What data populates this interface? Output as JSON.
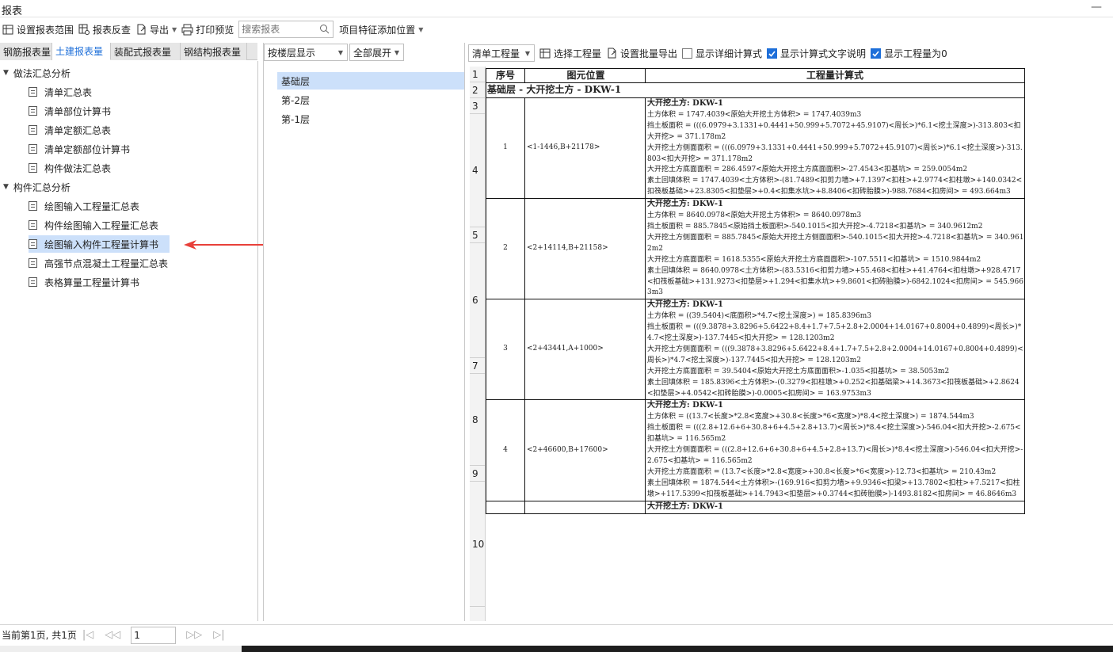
{
  "window": {
    "title": "报表",
    "minimize": "—"
  },
  "toolbar": {
    "set_range": "设置报表范围",
    "report_check": "报表反查",
    "export": "导出",
    "print_preview": "打印预览",
    "search_placeholder": "搜索报表",
    "feature_position": "项目特征添加位置"
  },
  "tabs": [
    "钢筋报表量",
    "土建报表量",
    "装配式报表量",
    "钢结构报表量"
  ],
  "tree": {
    "group1": "做法汇总分析",
    "group1_items": [
      "清单汇总表",
      "清单部位计算书",
      "清单定额汇总表",
      "清单定额部位计算书",
      "构件做法汇总表"
    ],
    "group2": "构件汇总分析",
    "group2_items": [
      "绘图输入工程量汇总表",
      "构件绘图输入工程量汇总表",
      "绘图输入构件工程量计算书",
      "高强节点混凝土工程量汇总表",
      "表格算量工程量计算书"
    ]
  },
  "mid": {
    "floor_mode": "按楼层显示",
    "expand": "全部展开",
    "floors": [
      "基础层",
      "第-2层",
      "第-1层"
    ]
  },
  "rtool": {
    "qty_type": "清单工程量",
    "select_qty": "选择工程量",
    "batch_export": "设置批量导出",
    "show_detail": "显示详细计算式",
    "show_text": "显示计算式文字说明",
    "show_zero": "显示工程量为0"
  },
  "report": {
    "headers": [
      "序号",
      "图元位置",
      "工程量计算式"
    ],
    "floor_row": "基础层 - 大开挖土方 - DKW-1",
    "row_numbers": [
      "1",
      "2",
      "3",
      "4",
      "5",
      "6",
      "7",
      "8",
      "9",
      "10"
    ],
    "rows": [
      {
        "seq": "1",
        "pos": "<1-1446,B+21178>",
        "title": "大开挖土方: DKW-1",
        "formula": "土方体积 = 1747.4039<原始大开挖土方体积> = 1747.4039m3\n挡土板面积 = (((6.0979+3.1331+0.4441+50.999+5.7072+45.9107)<周长>)*6.1<挖土深度>)-313.803<扣大开挖> = 371.178m2\n大开挖土方侧面面积 = (((6.0979+3.1331+0.4441+50.999+5.7072+45.9107)<周长>)*6.1<挖土深度>)-313.803<扣大开挖> = 371.178m2\n大开挖土方底面面积 = 286.4597<原始大开挖土方底面面积>-27.4543<扣基坑> = 259.0054m2\n素土回填体积 = 1747.4039<土方体积>-(81.7489<扣剪力墙>+7.1397<扣柱>+2.9774<扣柱墩>+140.0342<扣筏板基础>+23.8305<扣垫层>+0.4<扣集水坑>+8.8406<扣砖胎膜>)-988.7684<扣房间> = 493.664m3"
      },
      {
        "seq": "2",
        "pos": "<2+14114,B+21158>",
        "title": "大开挖土方: DKW-1",
        "formula": "土方体积 = 8640.0978<原始大开挖土方体积> = 8640.0978m3\n挡土板面积 = 885.7845<原始挡土板面积>-540.1015<扣大开挖>-4.7218<扣基坑> = 340.9612m2\n大开挖土方侧面面积 = 885.7845<原始大开挖土方侧面面积>-540.1015<扣大开挖>-4.7218<扣基坑> = 340.9612m2\n大开挖土方底面面积 = 1618.5355<原始大开挖土方底面面积>-107.5511<扣基坑> = 1510.9844m2\n素土回填体积 = 8640.0978<土方体积>-(83.5316<扣剪力墙>+55.468<扣柱>+41.4764<扣柱墩>+928.4717<扣筏板基础>+131.9273<扣垫层>+1.294<扣集水坑>+9.8601<扣砖胎膜>)-6842.1024<扣房间> = 545.9663m3"
      },
      {
        "seq": "3",
        "pos": "<2+43441,A+1000>",
        "title": "大开挖土方: DKW-1",
        "formula": "土方体积 = ((39.5404)<底面积>*4.7<挖土深度>) = 185.8396m3\n挡土板面积 = (((9.3878+3.8296+5.6422+8.4+1.7+7.5+2.8+2.0004+14.0167+0.8004+0.4899)<周长>)*4.7<挖土深度>)-137.7445<扣大开挖> = 128.1203m2\n大开挖土方侧面面积 = (((9.3878+3.8296+5.6422+8.4+1.7+7.5+2.8+2.0004+14.0167+0.8004+0.4899)<周长>)*4.7<挖土深度>)-137.7445<扣大开挖> = 128.1203m2\n大开挖土方底面面积 = 39.5404<原始大开挖土方底面面积>-1.035<扣基坑> = 38.5053m2\n素土回填体积 = 185.8396<土方体积>-(0.3279<扣柱墩>+0.252<扣基础梁>+14.3673<扣筏板基础>+2.8624<扣垫层>+4.0542<扣砖胎膜>)-0.0005<扣房间> = 163.9753m3"
      },
      {
        "seq": "4",
        "pos": "<2+46600,B+17600>",
        "title": "大开挖土方: DKW-1",
        "formula": "土方体积 = ((13.7<长度>*2.8<宽度>+30.8<长度>*6<宽度>)*8.4<挖土深度>) = 1874.544m3\n挡土板面积 = (((2.8+12.6+6+30.8+6+4.5+2.8+13.7)<周长>)*8.4<挖土深度>)-546.04<扣大开挖>-2.675<扣基坑> = 116.565m2\n大开挖土方侧面面积 = (((2.8+12.6+6+30.8+6+4.5+2.8+13.7)<周长>)*8.4<挖土深度>)-546.04<扣大开挖>-2.675<扣基坑> = 116.565m2\n大开挖土方底面面积 = (13.7<长度>*2.8<宽度>+30.8<长度>*6<宽度>)-12.73<扣基坑> = 210.43m2\n素土回填体积 = 1874.544<土方体积>-(169.916<扣剪力墙>+9.9346<扣梁>+13.7802<扣柱>+7.5217<扣柱墩>+117.5399<扣筏板基础>+14.7943<扣垫层>+0.3744<扣砖胎膜>)-1493.8182<扣房间> = 46.8646m3"
      },
      {
        "seq": "",
        "pos": "",
        "title": "大开挖土方: DKW-1",
        "formula": ""
      }
    ]
  },
  "status": {
    "page_text": "当前第1页, 共1页",
    "page_input": "1"
  },
  "colors": {
    "accent": "#1e6fd9",
    "selected": "#cce0fa",
    "arrow": "#e8403a"
  }
}
